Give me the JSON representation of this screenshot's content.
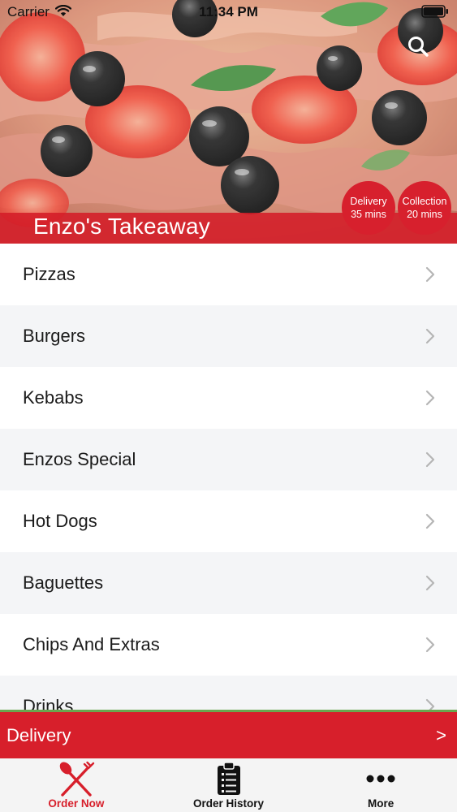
{
  "status_bar": {
    "carrier": "Carrier",
    "time": "11:34 PM"
  },
  "restaurant": {
    "name": "Enzo's Takeaway"
  },
  "badges": {
    "delivery": {
      "label": "Delivery",
      "time": "35 mins"
    },
    "collection": {
      "label": "Collection",
      "time": "20 mins"
    }
  },
  "categories": [
    {
      "label": "Pizzas"
    },
    {
      "label": "Burgers"
    },
    {
      "label": "Kebabs"
    },
    {
      "label": "Enzos Special"
    },
    {
      "label": "Hot Dogs"
    },
    {
      "label": "Baguettes"
    },
    {
      "label": "Chips And Extras"
    },
    {
      "label": "Drinks"
    }
  ],
  "delivery_bar": {
    "label": "Delivery",
    "arrow": ">"
  },
  "tabs": [
    {
      "label": "Order Now",
      "icon": "fork-knife-icon",
      "active": true
    },
    {
      "label": "Order History",
      "icon": "clipboard-icon",
      "active": false
    },
    {
      "label": "More",
      "icon": "more-dots-icon",
      "active": false
    }
  ],
  "colors": {
    "brand_red": "#d71f2b",
    "row_alt": "#f4f5f7",
    "delivery_bar_top_border": "#6aa84f",
    "tab_bar_bg": "#f4f4f4"
  },
  "icons": {
    "search": "search-icon",
    "chevron": "chevron-right-icon",
    "wifi": "wifi-icon",
    "battery": "battery-icon"
  }
}
